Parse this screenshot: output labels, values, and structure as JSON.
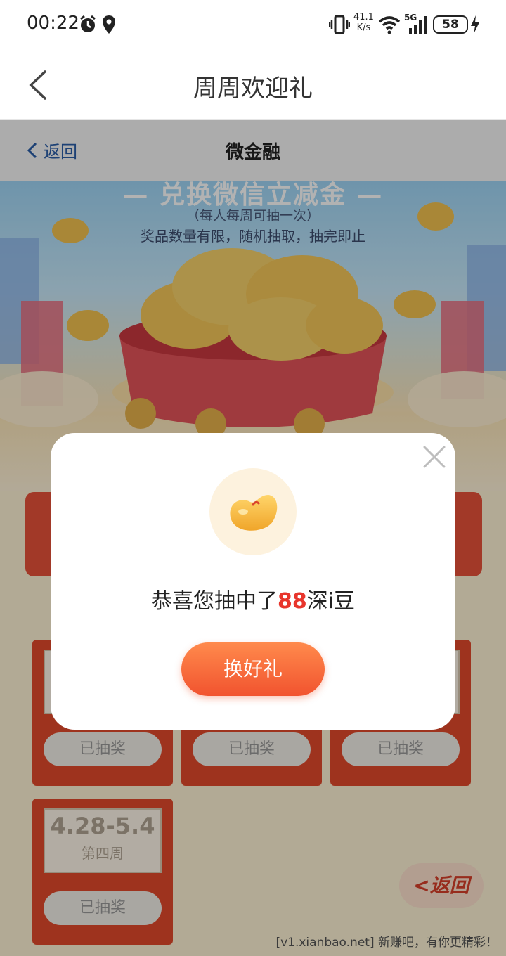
{
  "status_bar": {
    "time": "00:22",
    "net_speed_value": "41.1",
    "net_speed_unit": "K/s",
    "network": "5G",
    "battery": "58"
  },
  "title_bar": {
    "title": "周周欢迎礼"
  },
  "web_header": {
    "back_label": "返回",
    "title": "微金融"
  },
  "banner": {
    "top_text": "— 兑换微信立减金 —",
    "sub1": "（每人每周可抽一次）",
    "sub2": "奖品数量有限，随机抽取，抽完即止"
  },
  "weeks": [
    {
      "date": "",
      "name": "",
      "button": "已抽奖"
    },
    {
      "date": "",
      "name": "",
      "button": "已抽奖"
    },
    {
      "date": "",
      "name": "",
      "button": "已抽奖"
    },
    {
      "date": "4.28-5.4",
      "name": "第四周",
      "button": "已抽奖"
    }
  ],
  "floating_back_label": "<返回",
  "footer_note": "[v1.xianbao.net] 新赚吧，有你更精彩！",
  "modal": {
    "message_prefix": "恭喜您抽中了",
    "highlight_amount": "88",
    "message_suffix": "深i豆",
    "button_label": "换好礼"
  },
  "colors": {
    "accent_red": "#e8352c",
    "button_gradient_top": "#ff8a4c",
    "button_gradient_bottom": "#f1532f",
    "card_red": "#e34a2b"
  },
  "icons": {
    "alarm": "alarm-icon",
    "location": "location-icon",
    "vibrate": "vibrate-icon",
    "wifi": "wifi-icon",
    "signal": "signal-icon",
    "charging": "charging-icon",
    "back": "chevron-left-icon",
    "close": "close-icon",
    "bean": "bean-icon"
  }
}
